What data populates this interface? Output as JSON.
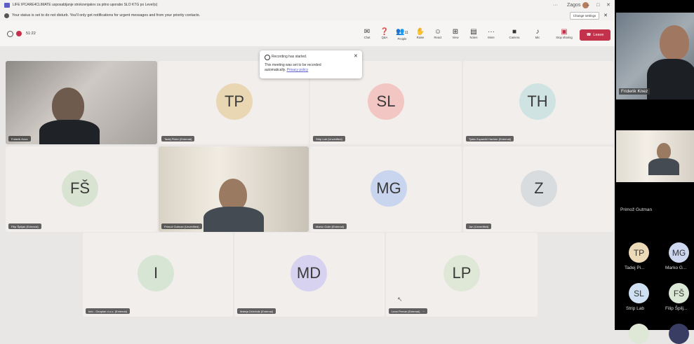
{
  "title_bar": {
    "title": "LIFE IPCARE4CLIMATE usposabljanje strokovnjakov za pitno uporabo SLO KTG po Level(s)",
    "controls": [
      "···",
      "Zagos",
      "–",
      "□",
      "✕"
    ]
  },
  "notice": {
    "text": "Your status is set to do not disturb. You'll only get notifications for urgent messages and from your priority contacts.",
    "change_settings": "Change settings",
    "close": "✕"
  },
  "meeting": {
    "timer": "51:22"
  },
  "toolbar": [
    {
      "icon": "chat-icon",
      "glyph": "✉",
      "label": "Chat"
    },
    {
      "icon": "qa-icon",
      "glyph": "❓",
      "label": "Q&A"
    },
    {
      "icon": "people-icon",
      "glyph": "👥",
      "label": "People",
      "count": "11"
    },
    {
      "icon": "raise-hand-icon",
      "glyph": "✋",
      "label": "Raise"
    },
    {
      "icon": "react-icon",
      "glyph": "☺",
      "label": "React"
    },
    {
      "icon": "view-icon",
      "glyph": "⊞",
      "label": "View"
    },
    {
      "icon": "notes-icon",
      "glyph": "▤",
      "label": "Notes"
    },
    {
      "icon": "more-icon",
      "glyph": "···",
      "label": "More"
    },
    {
      "icon": "camera-icon",
      "glyph": "■",
      "label": "Camera"
    },
    {
      "icon": "mic-icon",
      "glyph": "♪",
      "label": "Mic"
    },
    {
      "icon": "share-icon",
      "glyph": "▣",
      "label": "Stop sharing"
    }
  ],
  "leave_label": "Leave",
  "toast": {
    "title": "Recording has started.",
    "body": "This meeting was set to be recorded automatically.",
    "link": "Privacy policy"
  },
  "tiles": [
    {
      "type": "video",
      "name": "Friderik Knez"
    },
    {
      "type": "avatar",
      "initials": "TP",
      "name": "Tadej Pilder (External)",
      "color": "#e9d6b3"
    },
    {
      "type": "avatar",
      "initials": "SL",
      "name": "Strip Lab (Unverified)",
      "color": "#f2c6c2"
    },
    {
      "type": "avatar",
      "initials": "TH",
      "name": "Tjaša Zupančič Hartner (External)",
      "color": "#cfe4e2"
    },
    {
      "type": "avatar",
      "initials": "FŠ",
      "name": "Filip Špiljak (External)",
      "color": "#d8e4d1"
    },
    {
      "type": "video",
      "name": "Primož Gutman (Unverified)"
    },
    {
      "type": "avatar",
      "initials": "MG",
      "name": "Marko Golin (External)",
      "color": "#c9d5ee"
    },
    {
      "type": "avatar",
      "initials": "Z",
      "name": "Jan (Unverified)",
      "color": "#d9dcde"
    },
    {
      "type": "avatar",
      "initials": "I",
      "name": "Info - Geoplan d.o.o. (External)",
      "color": "#d7e5d4"
    },
    {
      "type": "avatar",
      "initials": "MD",
      "name": "Mateja Držečnik (External)",
      "color": "#d7d2ef"
    },
    {
      "type": "avatar",
      "initials": "LP",
      "name": "Leon Pernar (External)",
      "color": "#dfe8d7"
    }
  ],
  "right_panel": {
    "main_name": "Friderik Knez",
    "second_name": "Primož Gutman",
    "avatars": [
      {
        "initials": "TP",
        "label": "Tadej Pi...",
        "color": "#ecd9b7"
      },
      {
        "initials": "MG",
        "label": "Marko G...",
        "color": "#cdd8f0"
      },
      {
        "initials": "SL",
        "label": "Strip Lab",
        "color": "#cfe0f2"
      },
      {
        "initials": "FŠ",
        "label": "Filip Špilj...",
        "color": "#dbe8d5"
      }
    ]
  },
  "colors": {
    "leave": "#c4314b",
    "accent": "#5b5fc7"
  }
}
